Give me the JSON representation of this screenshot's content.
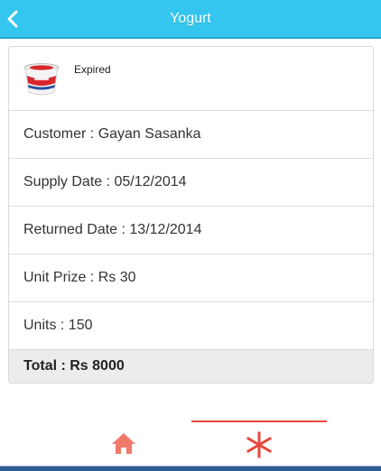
{
  "header": {
    "title": "Yogurt",
    "back_icon": "chevron-left-icon"
  },
  "item": {
    "image": "yogurt-cup-thumbnail",
    "status": "Expired"
  },
  "details": {
    "customer": "Customer : Gayan Sasanka",
    "supply_date": "Supply Date : 05/12/2014",
    "returned_date": "Returned Date : 13/12/2014",
    "unit_prize": "Unit Prize : Rs 30",
    "units": "Units : 150",
    "total": "Total : Rs 8000"
  },
  "navbar": {
    "items": [
      {
        "icon": "home-icon",
        "active": false
      },
      {
        "icon": "asterisk-icon",
        "active": true
      }
    ]
  },
  "colors": {
    "header_bg": "#34c6ee",
    "accent": "#e8473a",
    "bottom_bar": "#2e5d95"
  }
}
